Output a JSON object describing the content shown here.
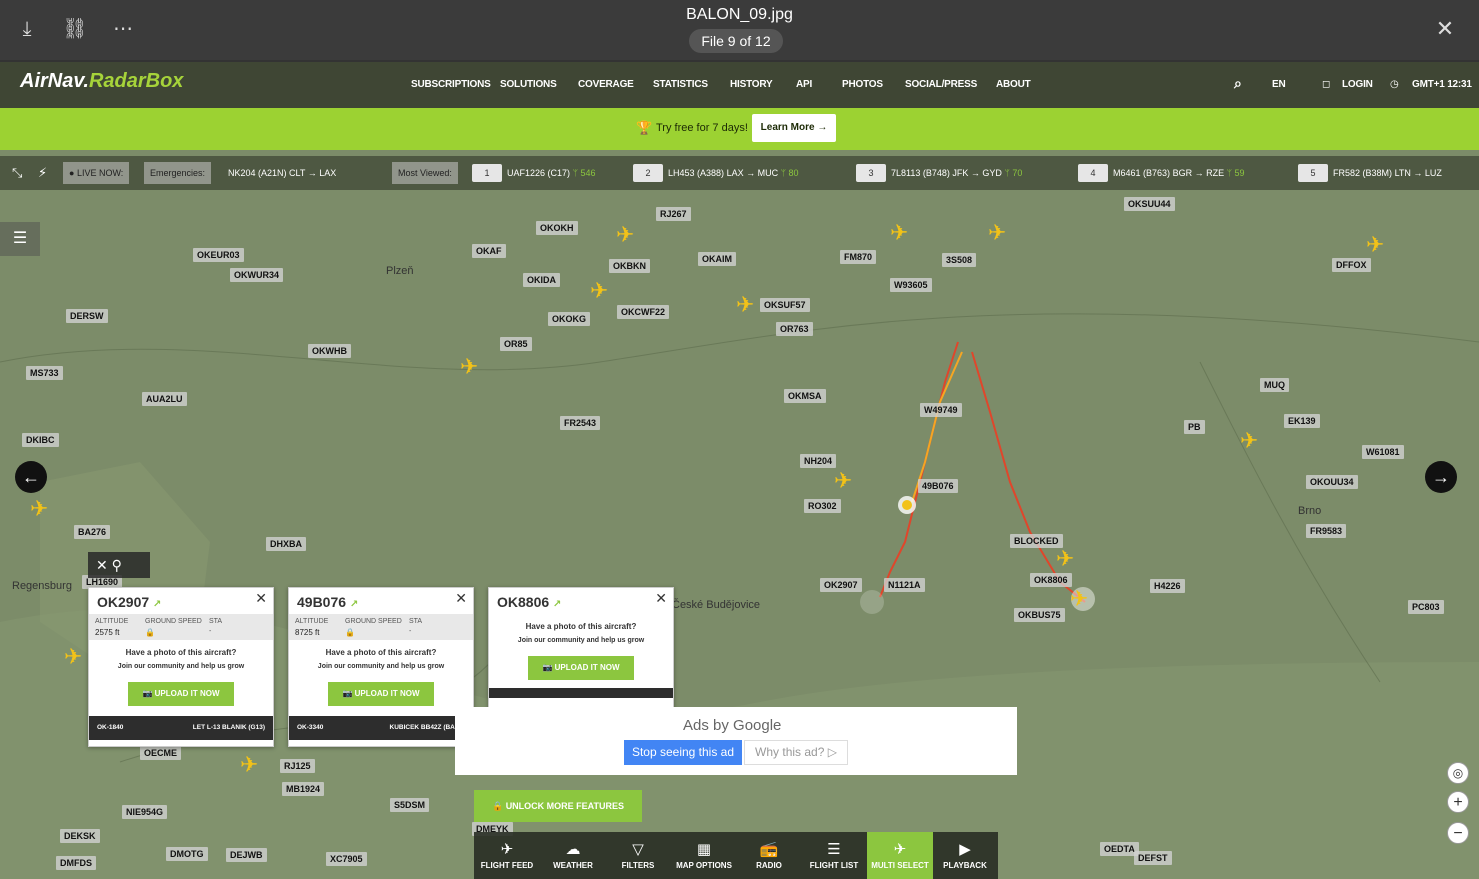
{
  "viewer": {
    "title": "BALON_09.jpg",
    "counter": "File 9 of 12",
    "download_icon": "download-icon",
    "link_icon": "link-icon",
    "more_icon": "more-icon",
    "close_icon": "close-icon"
  },
  "app": {
    "logo_main": "AirNav",
    "logo_accent": "RadarBox",
    "nav": [
      "SUBSCRIPTIONS",
      "SOLUTIONS",
      "COVERAGE",
      "STATISTICS",
      "HISTORY",
      "API",
      "PHOTOS",
      "SOCIAL/PRESS",
      "ABOUT"
    ],
    "language": "EN",
    "login": "LOGIN",
    "time": "GMT+1 12:31"
  },
  "promo": {
    "text": "Try free for 7 days!",
    "button": "Learn More"
  },
  "livebar": {
    "live_label": "LIVE NOW:",
    "emergencies_label": "Emergencies:",
    "emergency": "NK204 (A21N)",
    "emergency_route": "CLT → LAX",
    "most_viewed_label": "Most Viewed:",
    "most_viewed": [
      {
        "rank": "1",
        "flight": "UAF1226 (C17)",
        "route": "",
        "count": "546"
      },
      {
        "rank": "2",
        "flight": "LH453 (A388)",
        "route": "LAX → MUC",
        "count": "80"
      },
      {
        "rank": "3",
        "flight": "7L8113 (B748)",
        "route": "JFK → GYD",
        "count": "70"
      },
      {
        "rank": "4",
        "flight": "M6461 (B763)",
        "route": "BGR → RZE",
        "count": "59"
      },
      {
        "rank": "5",
        "flight": "FR582 (B38M)",
        "route": "LTN → LUZ",
        "count": ""
      }
    ]
  },
  "map": {
    "places": [
      "Plzeň",
      "Regensburg",
      "Brno",
      "České Budějovice"
    ],
    "labels": [
      "RJ267",
      "OKOKH",
      "OKAF",
      "OKEUR03",
      "OKWUR34",
      "OKIDA",
      "OKBKN",
      "OKAIM",
      "FM870",
      "3S508",
      "W93605",
      "OKSUF57",
      "OR763",
      "OKOKG",
      "OKCWF22",
      "DERSW",
      "OR85",
      "OKWHB",
      "MS733",
      "AUA2LU",
      "FR2543",
      "OKMSA",
      "W49749",
      "NH204",
      "RO302",
      "49B076",
      "DKIBC",
      "BA276",
      "DHXBA",
      "LH1690",
      "OK2907",
      "N1121A",
      "BLOCKED",
      "OK8806",
      "OKBUS75",
      "H4226",
      "PC803",
      "MUQ",
      "EK139",
      "W61081",
      "OKOUU34",
      "FR9583",
      "OKSUU44",
      "DFFOX",
      "OECME",
      "RJ125",
      "MB1924",
      "NIE954G",
      "S5DSM",
      "DEKSK",
      "DMFDS",
      "DMOTG",
      "DEJWB",
      "XC7905",
      "DMEYK",
      "OEDTA",
      "DEFST",
      "PB"
    ]
  },
  "cards": [
    {
      "callsign": "OK2907",
      "alt_label": "ALTITUDE",
      "alt": "2575 ft",
      "gs_label": "GROUND SPEED",
      "gs": "",
      "sta_label": "STA",
      "sta": "-",
      "prompt": "Have a photo of this aircraft?",
      "sub": "Join our community and help us grow",
      "upload": "UPLOAD IT NOW",
      "reg": "OK-1840",
      "type": "LET L-13 BLANIK (G13)"
    },
    {
      "callsign": "49B076",
      "alt_label": "ALTITUDE",
      "alt": "8725 ft",
      "gs_label": "GROUND SPEED",
      "gs": "",
      "sta_label": "STA",
      "sta": "-",
      "prompt": "Have a photo of this aircraft?",
      "sub": "Join our community and help us grow",
      "upload": "UPLOAD IT NOW",
      "reg": "OK-3340",
      "type": "KUBICEK BB42Z (BALL)"
    },
    {
      "callsign": "OK8806",
      "prompt": "Have a photo of this aircraft?",
      "sub": "Join our community and help us grow",
      "upload": "UPLOAD IT NOW"
    }
  ],
  "ad": {
    "ads_by": "Ads by Google",
    "stop": "Stop seeing this ad",
    "why": "Why this ad?"
  },
  "unlock": "UNLOCK MORE FEATURES",
  "bottom": [
    "FLIGHT FEED",
    "WEATHER",
    "FILTERS",
    "MAP OPTIONS",
    "RADIO",
    "FLIGHT LIST",
    "MULTI SELECT",
    "PLAYBACK"
  ],
  "bottom_icons": [
    "plane-feed-icon",
    "weather-icon",
    "filter-icon",
    "map-options-icon",
    "radio-icon",
    "flight-list-icon",
    "multi-select-icon",
    "playback-icon"
  ],
  "colors": {
    "accent": "#8cc63f",
    "promo": "#9cd232",
    "plane": "#f2c218",
    "track_orange": "#f5a623",
    "track_red": "#e0462b"
  }
}
